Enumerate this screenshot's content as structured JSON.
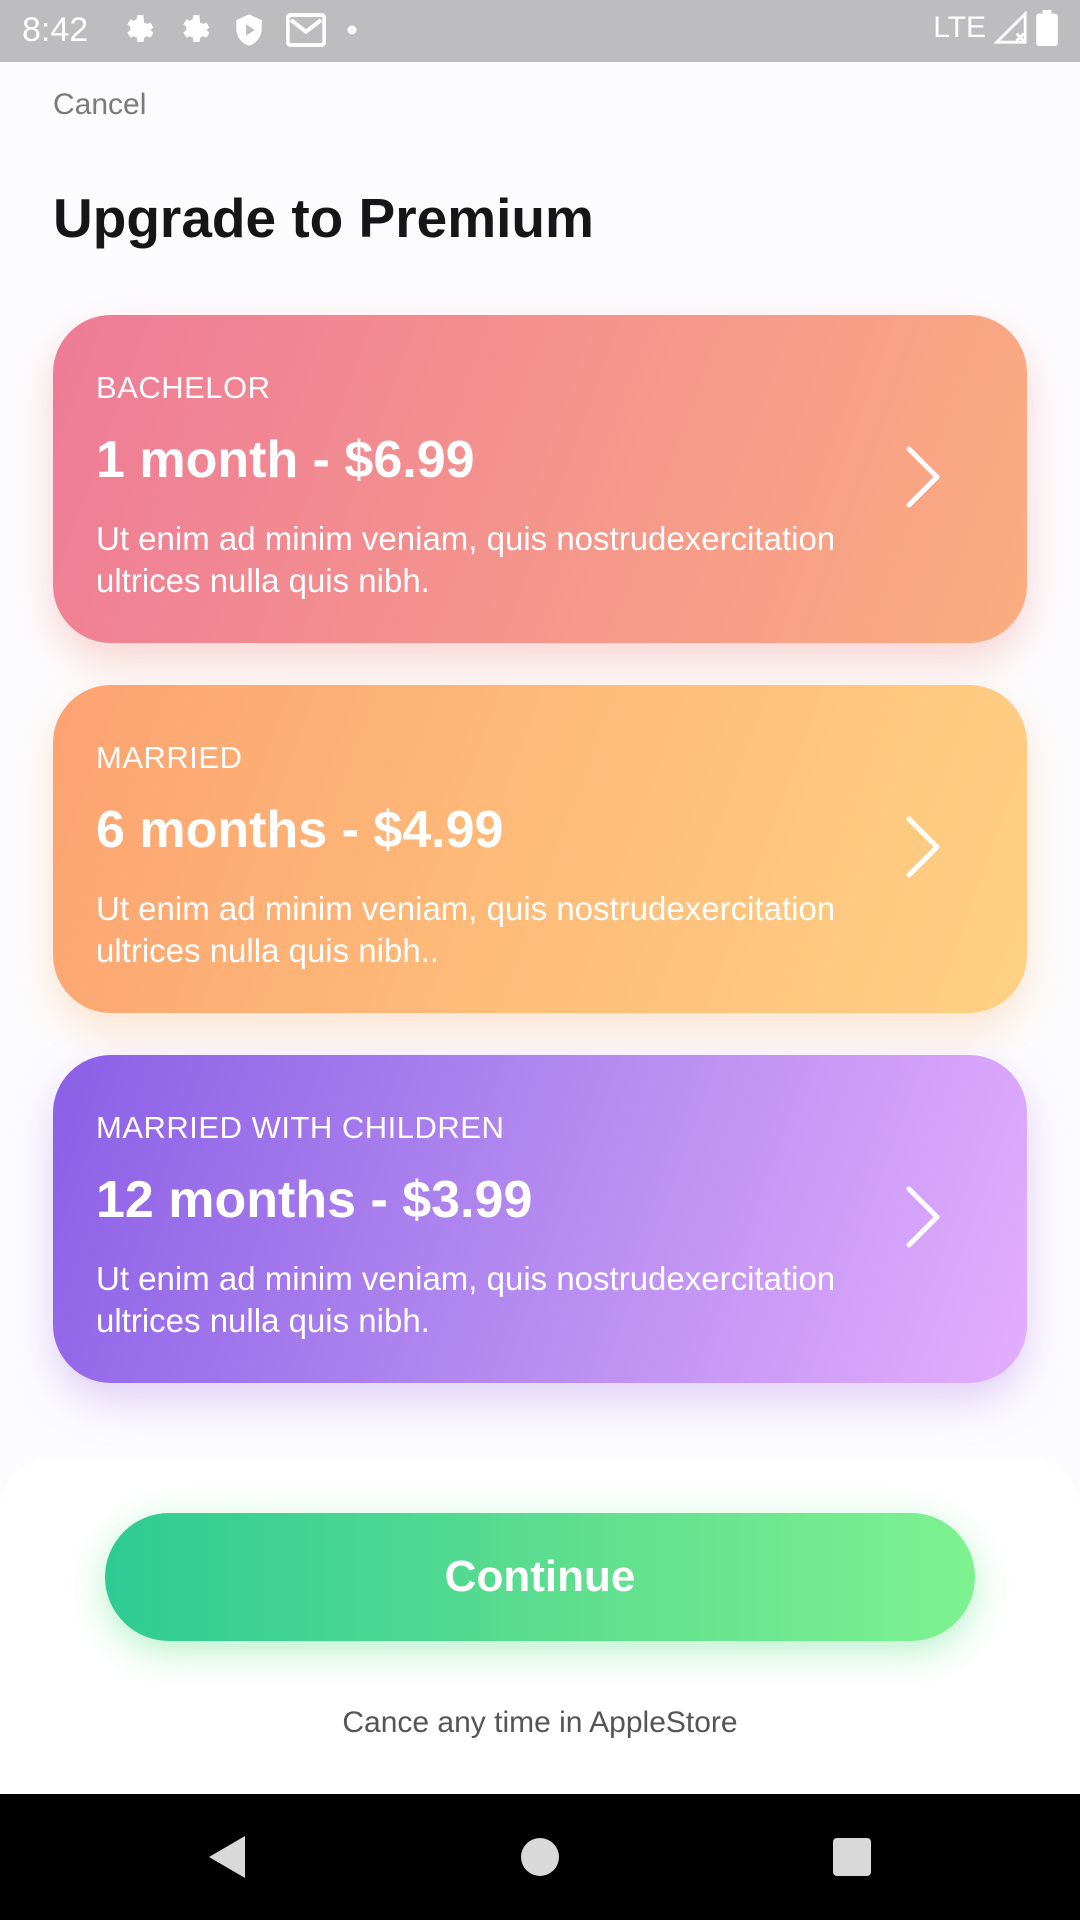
{
  "status_bar": {
    "time": "8:42",
    "network": "LTE",
    "icons": [
      "gear-icon",
      "gear-icon",
      "shield-icon",
      "mail-icon",
      "dot-icon",
      "signal-icon",
      "battery-icon"
    ]
  },
  "header": {
    "cancel_label": "Cancel",
    "title": "Upgrade to Premium"
  },
  "plans": [
    {
      "label": "BACHELOR",
      "price": "1 month - $6.99",
      "description": "Ut enim ad minim veniam, quis nostrudexercitation ultrices nulla quis nibh.",
      "colors": [
        "#ee7b97",
        "#fbad80"
      ]
    },
    {
      "label": "MARRIED",
      "price": "6 months - $4.99",
      "description": "Ut enim ad minim veniam, quis nostrudexercitation ultrices nulla quis nibh..",
      "colors": [
        "#fca271",
        "#fed184"
      ]
    },
    {
      "label": "MARRIED WITH CHILDREN",
      "price": "12 months - $3.99",
      "description": "Ut enim ad minim veniam, quis nostrudexercitation ultrices nulla quis nibh.",
      "colors": [
        "#8b5fe6",
        "#e4aefd"
      ]
    }
  ],
  "footer": {
    "continue_label": "Continue",
    "note": "Cance any time in AppleStore",
    "continue_colors": [
      "#2ecb95",
      "#7ef290"
    ]
  },
  "nav_bar": {
    "icons": [
      "back-icon",
      "home-icon",
      "recents-icon"
    ]
  }
}
